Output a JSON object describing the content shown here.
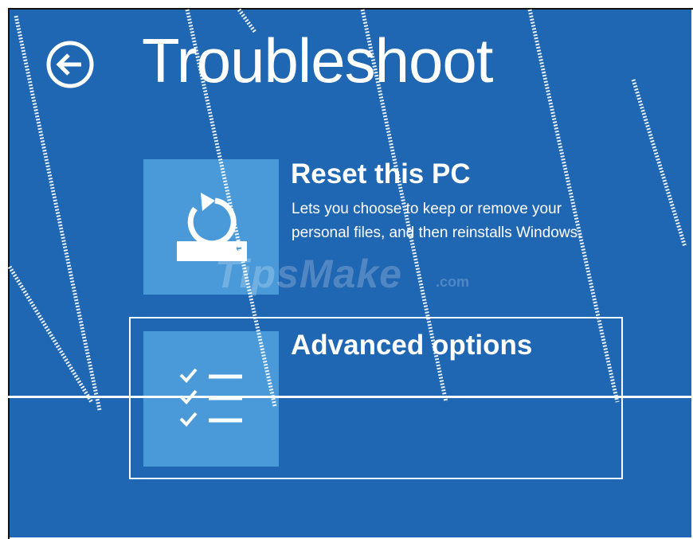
{
  "header": {
    "title": "Troubleshoot",
    "back_icon": "arrow-left-circle-icon"
  },
  "options": [
    {
      "title": "Reset this PC",
      "description": "Lets you choose to keep or remove your personal files, and then reinstalls Windows.",
      "icon": "reset-pc-icon"
    },
    {
      "title": "Advanced options",
      "icon": "checklist-icon"
    }
  ],
  "watermark": {
    "text": "TipsMake",
    "suffix": ".com"
  },
  "colors": {
    "background": "#1f66b3",
    "tile": "#4a9ad9",
    "text": "#ffffff"
  }
}
